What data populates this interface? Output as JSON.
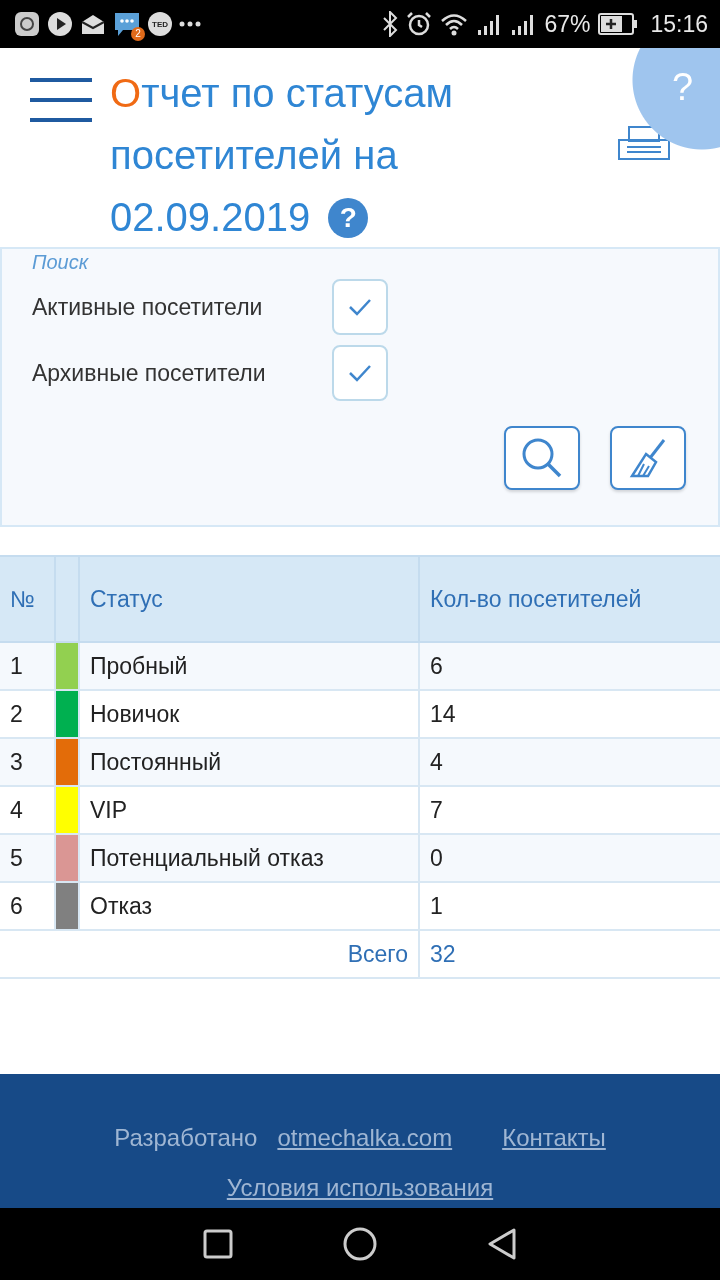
{
  "status_bar": {
    "notification_badge": "2",
    "ted_label": "TED",
    "battery": "67%",
    "time": "15:16"
  },
  "header": {
    "title": "Отчет по статусам посетителей на 02.09.2019",
    "help_badge": "?",
    "help_corner": "?"
  },
  "search": {
    "legend": "Поиск",
    "filters": [
      {
        "label": "Активные посетители",
        "checked": true
      },
      {
        "label": "Архивные посетители",
        "checked": true
      }
    ]
  },
  "table": {
    "columns": [
      "№",
      "Статус",
      "Кол-во посетителей"
    ],
    "rows": [
      {
        "number": "1",
        "color": "#92d050",
        "status": "Пробный",
        "count": "6"
      },
      {
        "number": "2",
        "color": "#00b050",
        "status": "Новичок",
        "count": "14"
      },
      {
        "number": "3",
        "color": "#e36c09",
        "status": "Постоянный",
        "count": "4"
      },
      {
        "number": "4",
        "color": "#ffff00",
        "status": "VIP",
        "count": "7"
      },
      {
        "number": "5",
        "color": "#da9694",
        "status": "Потенциальный отказ",
        "count": "0"
      },
      {
        "number": "6",
        "color": "#808080",
        "status": "Отказ",
        "count": "1"
      }
    ],
    "total_label": "Всего",
    "total": "32"
  },
  "footer": {
    "developed_by": "Разработано",
    "site_link": "otmechalka.com",
    "contacts_link": "Контакты",
    "terms_link": "Условия использования"
  }
}
